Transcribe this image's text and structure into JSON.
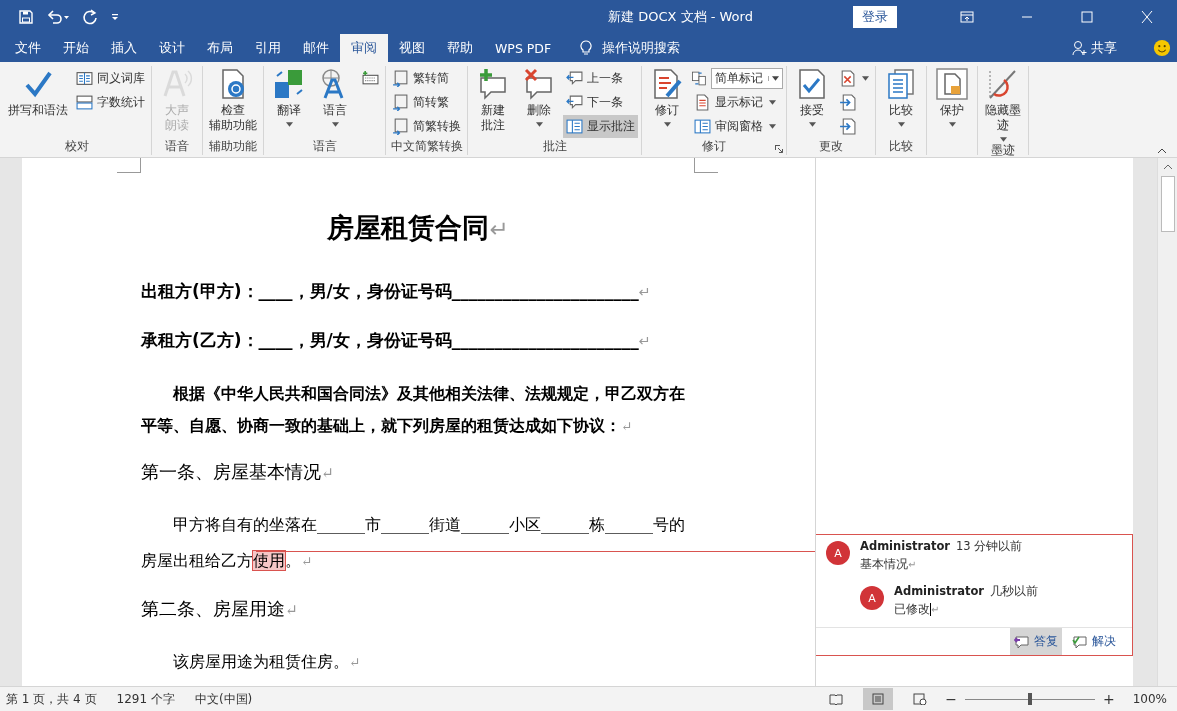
{
  "window": {
    "title": "新建 DOCX 文档  -  Word",
    "sign_in": "登录"
  },
  "menu_tabs": [
    {
      "label": "文件",
      "selected": false
    },
    {
      "label": "开始",
      "selected": false
    },
    {
      "label": "插入",
      "selected": false
    },
    {
      "label": "设计",
      "selected": false
    },
    {
      "label": "布局",
      "selected": false
    },
    {
      "label": "引用",
      "selected": false
    },
    {
      "label": "邮件",
      "selected": false
    },
    {
      "label": "审阅",
      "selected": true
    },
    {
      "label": "视图",
      "selected": false
    },
    {
      "label": "帮助",
      "selected": false
    },
    {
      "label": "WPS PDF",
      "selected": false
    }
  ],
  "tell_me": "操作说明搜索",
  "share": "共享",
  "ribbon_groups": [
    {
      "label": "校对",
      "items": [
        {
          "kind": "large",
          "label": "拼写和语法",
          "dropdown": false,
          "disabled": false,
          "selected": false
        },
        {
          "kind": "small",
          "label": "同义词库",
          "dropdown": false,
          "disabled": false,
          "selected": false
        },
        {
          "kind": "small",
          "label": "字数统计",
          "dropdown": false,
          "disabled": false,
          "selected": false
        }
      ]
    },
    {
      "label": "语音",
      "items": [
        {
          "kind": "large",
          "label": [
            "大声",
            "朗读"
          ],
          "dropdown": false,
          "disabled": true,
          "selected": false
        }
      ]
    },
    {
      "label": "辅助功能",
      "items": [
        {
          "kind": "large",
          "label": [
            "检查",
            "辅助功能"
          ],
          "dropdown": false,
          "disabled": false,
          "selected": false
        }
      ]
    },
    {
      "label": "语言",
      "items": [
        {
          "kind": "large",
          "label": "翻译",
          "dropdown": true,
          "disabled": false,
          "selected": false
        },
        {
          "kind": "large",
          "label": "语言",
          "dropdown": true,
          "disabled": false,
          "selected": false
        },
        {
          "kind": "icon",
          "dropdown": false,
          "disabled": false,
          "selected": false
        }
      ]
    },
    {
      "label": "中文简繁转换",
      "items": [
        {
          "kind": "small",
          "label": "繁转简",
          "dropdown": false,
          "disabled": false,
          "selected": false
        },
        {
          "kind": "small",
          "label": "简转繁",
          "dropdown": false,
          "disabled": false,
          "selected": false
        },
        {
          "kind": "small",
          "label": "简繁转换",
          "dropdown": false,
          "disabled": false,
          "selected": false
        }
      ]
    },
    {
      "label": "批注",
      "items": [
        {
          "kind": "large",
          "label": [
            "新建",
            "批注"
          ],
          "dropdown": false,
          "disabled": false,
          "selected": false
        },
        {
          "kind": "large",
          "label": "删除",
          "dropdown": true,
          "disabled": false,
          "selected": false
        },
        {
          "kind": "small",
          "label": "上一条",
          "dropdown": false,
          "disabled": false,
          "selected": false
        },
        {
          "kind": "small",
          "label": "下一条",
          "dropdown": false,
          "disabled": false,
          "selected": false
        },
        {
          "kind": "small",
          "label": "显示批注",
          "dropdown": false,
          "disabled": false,
          "selected": true
        }
      ]
    },
    {
      "label": "修订",
      "launcher": true,
      "items": [
        {
          "kind": "large",
          "label": "修订",
          "dropdown": true,
          "disabled": false,
          "selected": false
        },
        {
          "kind": "combo",
          "label": "简单标记",
          "dropdown": true,
          "disabled": false,
          "selected": false
        },
        {
          "kind": "small",
          "label": "显示标记",
          "dropdown": true,
          "disabled": false,
          "selected": false
        },
        {
          "kind": "small",
          "label": "审阅窗格",
          "dropdown": true,
          "disabled": false,
          "selected": false
        }
      ]
    },
    {
      "label": "更改",
      "items": [
        {
          "kind": "large",
          "label": "接受",
          "dropdown": true,
          "disabled": false,
          "selected": false
        },
        {
          "kind": "icon",
          "dropdown": true,
          "disabled": false,
          "selected": false
        },
        {
          "kind": "icon",
          "dropdown": false,
          "disabled": false,
          "selected": false
        },
        {
          "kind": "icon",
          "dropdown": false,
          "disabled": false,
          "selected": false
        }
      ]
    },
    {
      "label": "比较",
      "items": [
        {
          "kind": "large",
          "label": "比较",
          "dropdown": true,
          "disabled": false,
          "selected": false
        }
      ]
    },
    {
      "items": [
        {
          "kind": "large",
          "label": "保护",
          "dropdown": true,
          "disabled": false,
          "selected": false
        }
      ]
    },
    {
      "label": "墨迹",
      "items": [
        {
          "kind": "large",
          "label": [
            "隐藏墨",
            "迹"
          ],
          "dropdown": true,
          "disabled": false,
          "selected": false
        }
      ]
    }
  ],
  "document": [
    {
      "kind": "title",
      "segments": [
        {
          "text": "房屋租赁合同",
          "commented": false
        }
      ],
      "end_mark": "↵"
    },
    {
      "kind": "party",
      "segments": [
        {
          "text": "出租方(甲方)：____，男/女，身份证号码______________________",
          "commented": false
        }
      ],
      "end_mark": "↵"
    },
    {
      "kind": "party",
      "segments": [
        {
          "text": "承租方(乙方)：____，男/女，身份证号码______________________",
          "commented": false
        }
      ],
      "end_mark": "↵"
    },
    {
      "kind": "preamble",
      "segments": [
        {
          "text": "根据《中华人民共和国合同法》及其他相关法律、法规规定，甲乙双方在平等、自愿、协商一致的基础上，就下列房屋的租赁达成如下协议：",
          "commented": false
        }
      ],
      "end_mark": "↵"
    },
    {
      "kind": "heading",
      "segments": [
        {
          "text": "第一条、房屋基本情况",
          "commented": false
        }
      ],
      "end_mark": "↵"
    },
    {
      "kind": "body",
      "segments": [
        {
          "text": "甲方将自有的坐落在______市______街道______小区______栋______号的房屋出租给乙方",
          "commented": false
        },
        {
          "text": "使用",
          "commented": true
        },
        {
          "text": "。",
          "commented": false
        }
      ],
      "end_mark": "↵"
    },
    {
      "kind": "heading",
      "segments": [
        {
          "text": "第二条、房屋用途",
          "commented": false
        }
      ],
      "end_mark": "↵"
    },
    {
      "kind": "body",
      "segments": [
        {
          "text": "该房屋用途为租赁住房。",
          "commented": false
        }
      ],
      "end_mark": "↵"
    }
  ],
  "comments": [
    {
      "avatar": "A",
      "author": "Administrator",
      "time": "13 分钟以前",
      "text": "基本情况",
      "end_mark": "↵",
      "replies": [
        {
          "avatar": "A",
          "author": "Administrator",
          "time": "几秒以前",
          "text": "已修改",
          "end_mark": "↵"
        }
      ]
    }
  ],
  "comment_actions": [
    {
      "label": "答复",
      "selected": true
    },
    {
      "label": "解决",
      "selected": false
    }
  ],
  "status_bar": {
    "page": "第 1 页，共 4 页",
    "words": "1291 个字",
    "language": "中文(中国)",
    "views": [
      {
        "selected": false
      },
      {
        "selected": true
      },
      {
        "selected": false
      }
    ],
    "zoom_minus": "−",
    "zoom_plus": "+",
    "zoom": {
      "level": 0.5
    },
    "zoom_reading": "100%"
  }
}
